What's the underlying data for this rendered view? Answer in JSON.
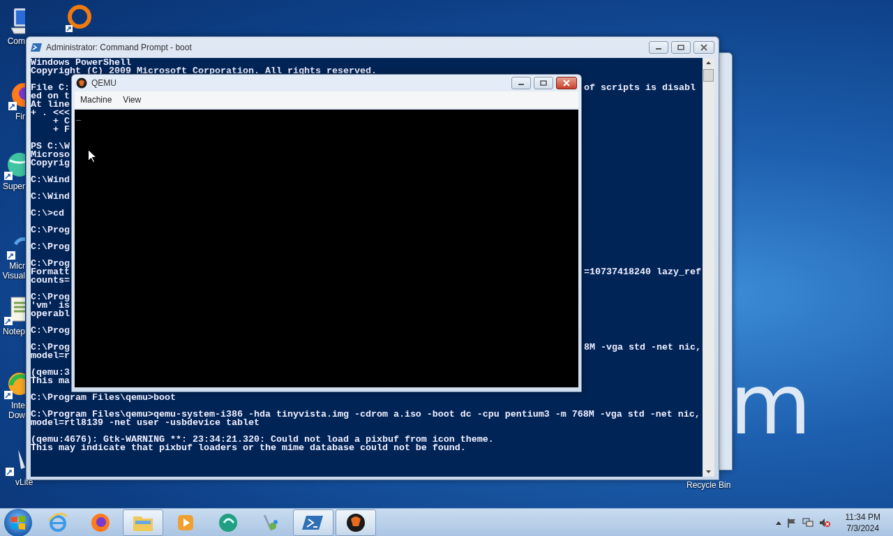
{
  "desktop": {
    "wallpaper_text": "m",
    "icons": [
      {
        "kind": "computer",
        "lines": [
          "Com"
        ]
      },
      {
        "kind": "ring"
      },
      {
        "kind": "firefox",
        "lines": [
          "Fir"
        ]
      },
      {
        "kind": "globe",
        "lines": [
          "Super"
        ]
      },
      {
        "kind": "studio",
        "lines": [
          "Micr",
          "Visual"
        ]
      },
      {
        "kind": "notepad",
        "lines": [
          "Notep"
        ]
      },
      {
        "kind": "download",
        "lines": [
          "Inte",
          "Dow"
        ]
      },
      {
        "kind": "vlite",
        "lines": [
          "vLite"
        ]
      },
      {
        "kind": "recycle",
        "lines": [
          "Recycle Bin"
        ]
      }
    ]
  },
  "console_window": {
    "title": "Administrator:  Command Prompt - boot",
    "lines": [
      {
        "kind": "text",
        "text": "Windows PowerShell"
      },
      {
        "kind": "text",
        "text": "Copyright (C) 2009 Microsoft Corporation. All rights reserved."
      },
      {
        "kind": "blank"
      },
      {
        "kind": "text",
        "text": "File C:",
        "right": "of scripts is disabl"
      },
      {
        "kind": "text",
        "text": "ed on t"
      },
      {
        "kind": "text",
        "text": "At line"
      },
      {
        "kind": "text",
        "text": "+ . <<<"
      },
      {
        "kind": "text",
        "text": "    + C"
      },
      {
        "kind": "text",
        "text": "    + F"
      },
      {
        "kind": "blank"
      },
      {
        "kind": "text",
        "text": "PS C:\\W"
      },
      {
        "kind": "text",
        "text": "Microso"
      },
      {
        "kind": "text",
        "text": "Copyrig"
      },
      {
        "kind": "blank"
      },
      {
        "kind": "text",
        "text": "C:\\Wind"
      },
      {
        "kind": "blank"
      },
      {
        "kind": "text",
        "text": "C:\\Wind"
      },
      {
        "kind": "blank"
      },
      {
        "kind": "text",
        "text": "C:\\>cd"
      },
      {
        "kind": "blank"
      },
      {
        "kind": "text",
        "text": "C:\\Prog"
      },
      {
        "kind": "blank"
      },
      {
        "kind": "text",
        "text": "C:\\Prog"
      },
      {
        "kind": "blank"
      },
      {
        "kind": "text",
        "text": "C:\\Prog"
      },
      {
        "kind": "text",
        "text": "Formatt",
        "right": "=10737418240 lazy_ref"
      },
      {
        "kind": "text",
        "text": "counts="
      },
      {
        "kind": "blank"
      },
      {
        "kind": "text",
        "text": "C:\\Prog"
      },
      {
        "kind": "text",
        "text": "'vm' is"
      },
      {
        "kind": "text",
        "text": "operabl"
      },
      {
        "kind": "blank"
      },
      {
        "kind": "text",
        "text": "C:\\Prog"
      },
      {
        "kind": "blank"
      },
      {
        "kind": "text",
        "text": "C:\\Prog",
        "right": "8M -vga std -net nic,"
      },
      {
        "kind": "text",
        "text": "model=r"
      },
      {
        "kind": "blank"
      },
      {
        "kind": "text",
        "text": "(qemu:3"
      },
      {
        "kind": "text",
        "text": "This ma"
      },
      {
        "kind": "blank"
      },
      {
        "kind": "text",
        "text": "C:\\Program Files\\qemu>boot"
      },
      {
        "kind": "blank"
      },
      {
        "kind": "text",
        "text": "C:\\Program Files\\qemu>qemu-system-i386 -hda tinyvista.img -cdrom a.iso -boot dc -cpu pentium3 -m 768M -vga std -net nic,"
      },
      {
        "kind": "text",
        "text": "model=rtl8139 -net user -usbdevice tablet"
      },
      {
        "kind": "blank"
      },
      {
        "kind": "text",
        "text": "(qemu:4676): Gtk-WARNING **: 23:34:21.320: Could not load a pixbuf from icon theme."
      },
      {
        "kind": "text",
        "text": "This may indicate that pixbuf loaders or the mime database could not be found."
      }
    ]
  },
  "qemu_window": {
    "title": "QEMU",
    "menus": [
      "Machine",
      "View"
    ],
    "screen_text": "_"
  },
  "taskbar": {
    "items": [
      {
        "kind": "ie",
        "active": false
      },
      {
        "kind": "firefox",
        "active": false
      },
      {
        "kind": "folder",
        "active": true
      },
      {
        "kind": "media",
        "active": false
      },
      {
        "kind": "green",
        "active": false
      },
      {
        "kind": "tool",
        "active": false
      },
      {
        "kind": "powershell",
        "active": true
      },
      {
        "kind": "qemu",
        "active": true
      }
    ],
    "clock": {
      "time": "11:34 PM",
      "date": "7/3/2024"
    }
  }
}
